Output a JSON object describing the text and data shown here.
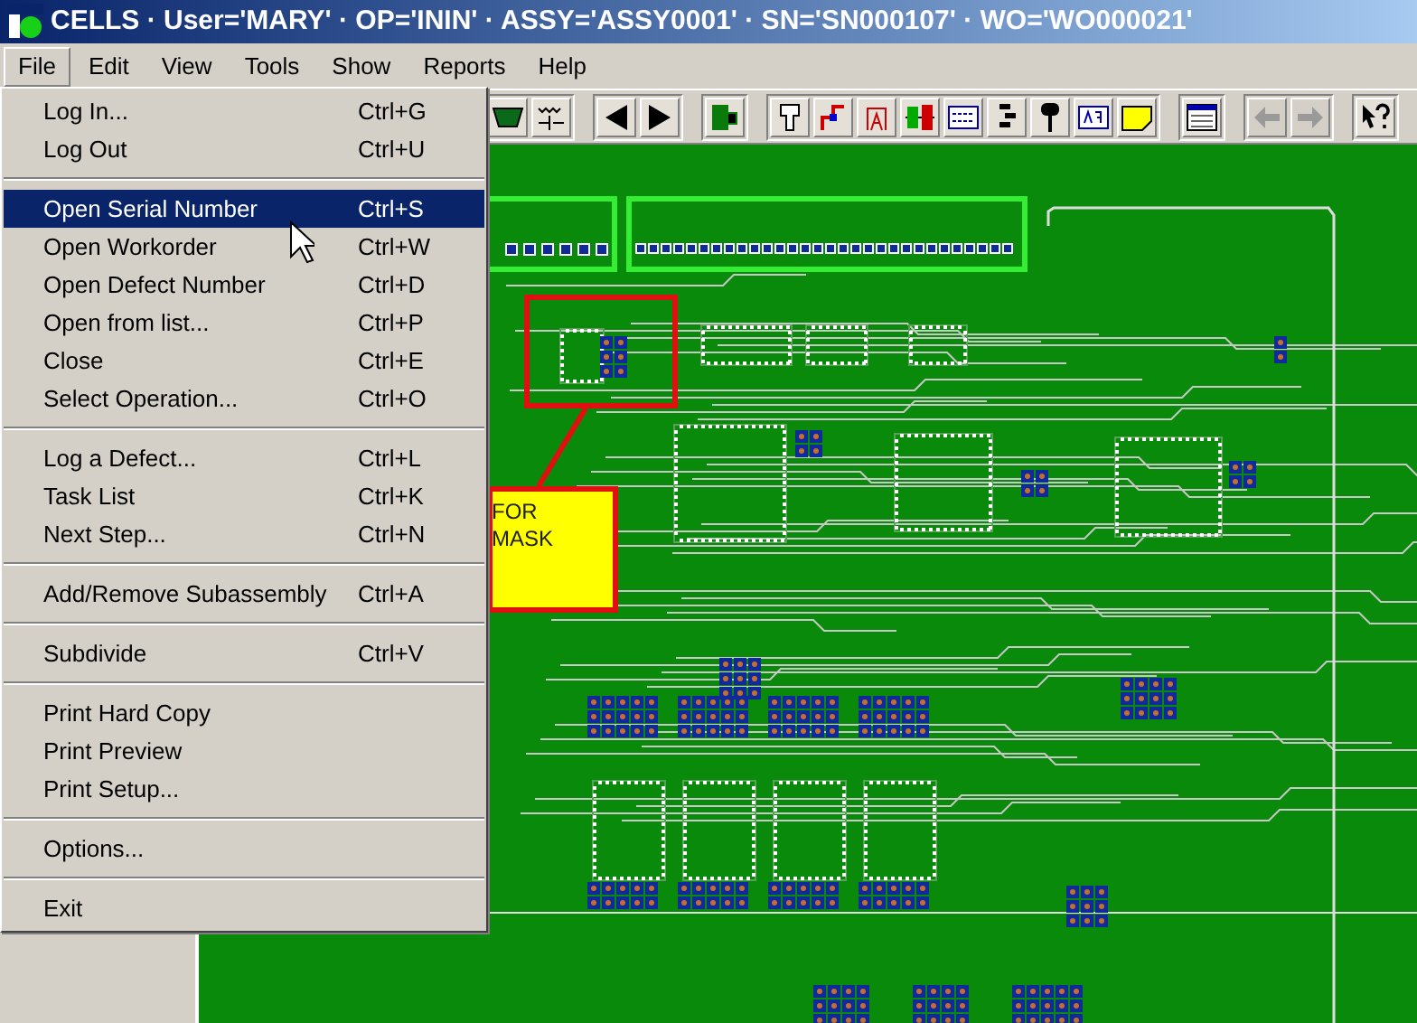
{
  "window": {
    "title": "CELLS · User='MARY' · OP='ININ' · ASSY='ASSY0001' · SN='SN000107' · WO='WO000021'"
  },
  "menubar": [
    {
      "label": "File",
      "selected": true
    },
    {
      "label": "Edit",
      "selected": false
    },
    {
      "label": "View",
      "selected": false
    },
    {
      "label": "Tools",
      "selected": false
    },
    {
      "label": "Show",
      "selected": false
    },
    {
      "label": "Reports",
      "selected": false
    },
    {
      "label": "Help",
      "selected": false
    }
  ],
  "toolbar": [
    [
      {
        "kind": "tray",
        "disabled": false
      },
      {
        "kind": "signal",
        "disabled": false
      }
    ],
    [
      {
        "kind": "left",
        "disabled": false
      },
      {
        "kind": "right",
        "disabled": false
      }
    ],
    [
      {
        "kind": "flag",
        "disabled": false
      }
    ],
    [
      {
        "kind": "probe",
        "disabled": false
      },
      {
        "kind": "route",
        "disabled": false
      },
      {
        "kind": "text",
        "disabled": false
      },
      {
        "kind": "part",
        "disabled": false
      },
      {
        "kind": "grid",
        "disabled": false
      },
      {
        "kind": "bars",
        "disabled": false
      },
      {
        "kind": "pin",
        "disabled": false
      },
      {
        "kind": "label",
        "disabled": false
      },
      {
        "kind": "note",
        "disabled": false
      }
    ],
    [
      {
        "kind": "table",
        "disabled": false
      }
    ],
    [
      {
        "kind": "back",
        "disabled": true
      },
      {
        "kind": "forward",
        "disabled": true
      }
    ],
    [
      {
        "kind": "help",
        "disabled": false
      }
    ]
  ],
  "file_menu": [
    [
      {
        "label": "Log In...",
        "shortcut": "Ctrl+G",
        "selected": false
      },
      {
        "label": "Log Out",
        "shortcut": "Ctrl+U",
        "selected": false
      }
    ],
    [
      {
        "label": "Open Serial Number",
        "shortcut": "Ctrl+S",
        "selected": true
      },
      {
        "label": "Open Workorder",
        "shortcut": "Ctrl+W",
        "selected": false
      },
      {
        "label": "Open Defect Number",
        "shortcut": "Ctrl+D",
        "selected": false
      },
      {
        "label": "Open from list...",
        "shortcut": "Ctrl+P",
        "selected": false
      },
      {
        "label": "Close",
        "shortcut": "Ctrl+E",
        "selected": false
      },
      {
        "label": "Select Operation...",
        "shortcut": "Ctrl+O",
        "selected": false
      }
    ],
    [
      {
        "label": "Log a Defect...",
        "shortcut": "Ctrl+L",
        "selected": false
      },
      {
        "label": "Task List",
        "shortcut": "Ctrl+K",
        "selected": false
      },
      {
        "label": "Next Step...",
        "shortcut": "Ctrl+N",
        "selected": false
      }
    ],
    [
      {
        "label": "Add/Remove Subassembly",
        "shortcut": "Ctrl+A",
        "selected": false
      }
    ],
    [
      {
        "label": "Subdivide",
        "shortcut": "Ctrl+V",
        "selected": false
      }
    ],
    [
      {
        "label": "Print Hard Copy",
        "selected": false
      },
      {
        "label": "Print Preview",
        "selected": false
      },
      {
        "label": "Print Setup...",
        "selected": false
      }
    ],
    [
      {
        "label": "Options...",
        "selected": false
      }
    ],
    [
      {
        "label": "Exit",
        "selected": false
      }
    ]
  ],
  "canvas": {
    "note_lines": [
      "FOR",
      "MASK"
    ]
  }
}
